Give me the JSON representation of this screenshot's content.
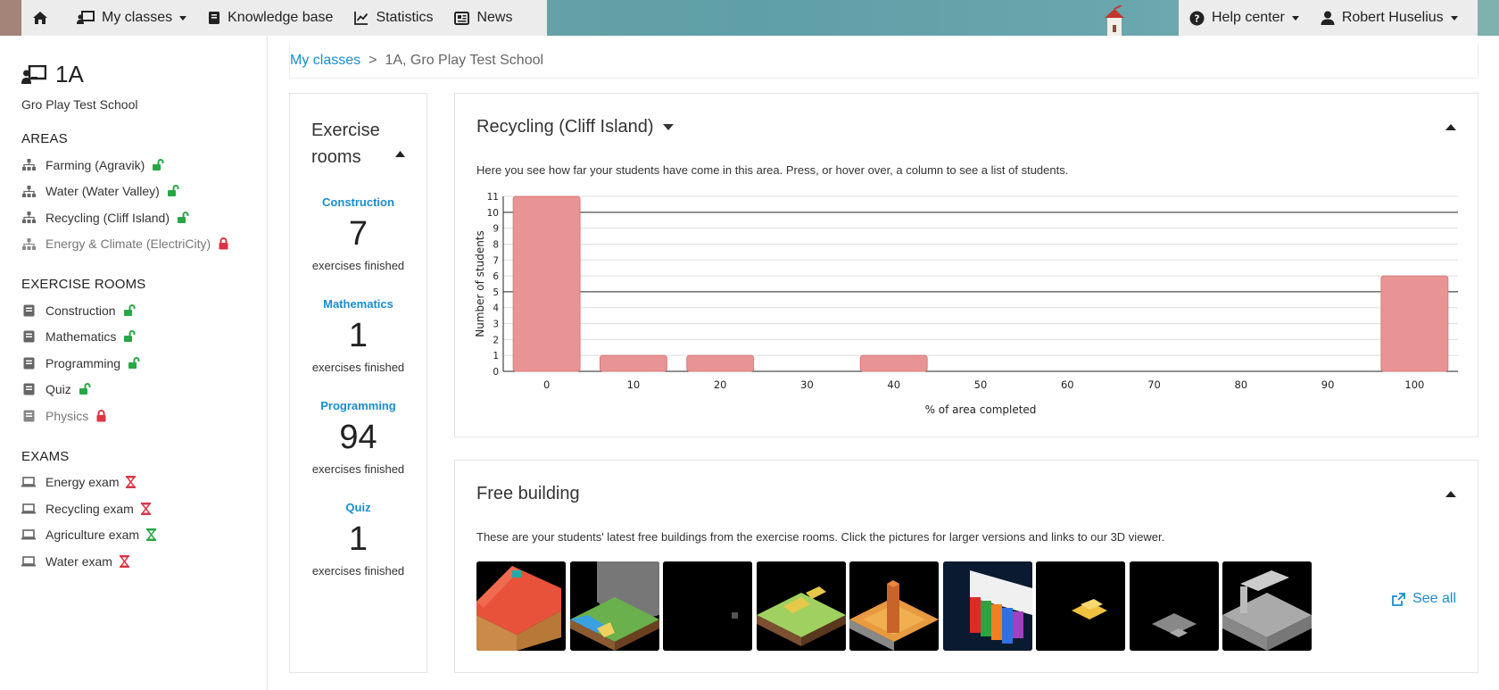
{
  "nav": {
    "my_classes": "My classes",
    "knowledge_base": "Knowledge base",
    "statistics": "Statistics",
    "news": "News",
    "help_center": "Help center",
    "user": "Robert Huselius"
  },
  "sidebar": {
    "class_name": "1A",
    "school": "Gro Play Test School",
    "areas_heading": "AREAS",
    "areas": [
      {
        "label": "Farming (Agravik)",
        "status": "unlocked"
      },
      {
        "label": "Water (Water Valley)",
        "status": "unlocked"
      },
      {
        "label": "Recycling (Cliff Island)",
        "status": "unlocked"
      },
      {
        "label": "Energy & Climate (ElectriCity)",
        "status": "locked"
      }
    ],
    "rooms_heading": "EXERCISE ROOMS",
    "rooms": [
      {
        "label": "Construction",
        "status": "unlocked"
      },
      {
        "label": "Mathematics",
        "status": "unlocked"
      },
      {
        "label": "Programming",
        "status": "unlocked"
      },
      {
        "label": "Quiz",
        "status": "unlocked"
      },
      {
        "label": "Physics",
        "status": "locked"
      }
    ],
    "exams_heading": "EXAMS",
    "exams": [
      {
        "label": "Energy exam",
        "status": "closed"
      },
      {
        "label": "Recycling exam",
        "status": "closed"
      },
      {
        "label": "Agriculture exam",
        "status": "open"
      },
      {
        "label": "Water exam",
        "status": "closed"
      }
    ]
  },
  "breadcrumb": {
    "root": "My classes",
    "separator": ">",
    "current": "1A, Gro Play Test School"
  },
  "exercise_rooms": {
    "title": "Exercise rooms",
    "items": [
      {
        "name": "Construction",
        "count": "7",
        "label": "exercises finished"
      },
      {
        "name": "Mathematics",
        "count": "1",
        "label": "exercises finished"
      },
      {
        "name": "Programming",
        "count": "94",
        "label": "exercises finished"
      },
      {
        "name": "Quiz",
        "count": "1",
        "label": "exercises finished"
      }
    ]
  },
  "area_panel": {
    "title": "Recycling (Cliff Island)",
    "description": "Here you see how far your students have come in this area. Press, or hover over, a column to see a list of students."
  },
  "chart_data": {
    "type": "bar",
    "categories": [
      "0",
      "10",
      "20",
      "30",
      "40",
      "50",
      "60",
      "70",
      "80",
      "90",
      "100"
    ],
    "values": [
      11,
      1,
      1,
      0,
      1,
      0,
      0,
      0,
      0,
      0,
      6
    ],
    "xlabel": "% of area completed",
    "ylabel": "Number of students",
    "ylim": [
      0,
      11
    ],
    "yticks": [
      "0",
      "1",
      "2",
      "3",
      "4",
      "5",
      "6",
      "7",
      "8",
      "9",
      "10",
      "11"
    ],
    "grid": true,
    "bar_color": "#e89494",
    "bar_border": "#d87a7a"
  },
  "free_building": {
    "title": "Free building",
    "description": "These are your students' latest free buildings from the exercise rooms. Click the pictures for larger versions and links to our 3D viewer.",
    "see_all": "See all"
  },
  "colors": {
    "link": "#1a8ccf",
    "unlocked": "#28a745",
    "locked": "#dc3545"
  }
}
